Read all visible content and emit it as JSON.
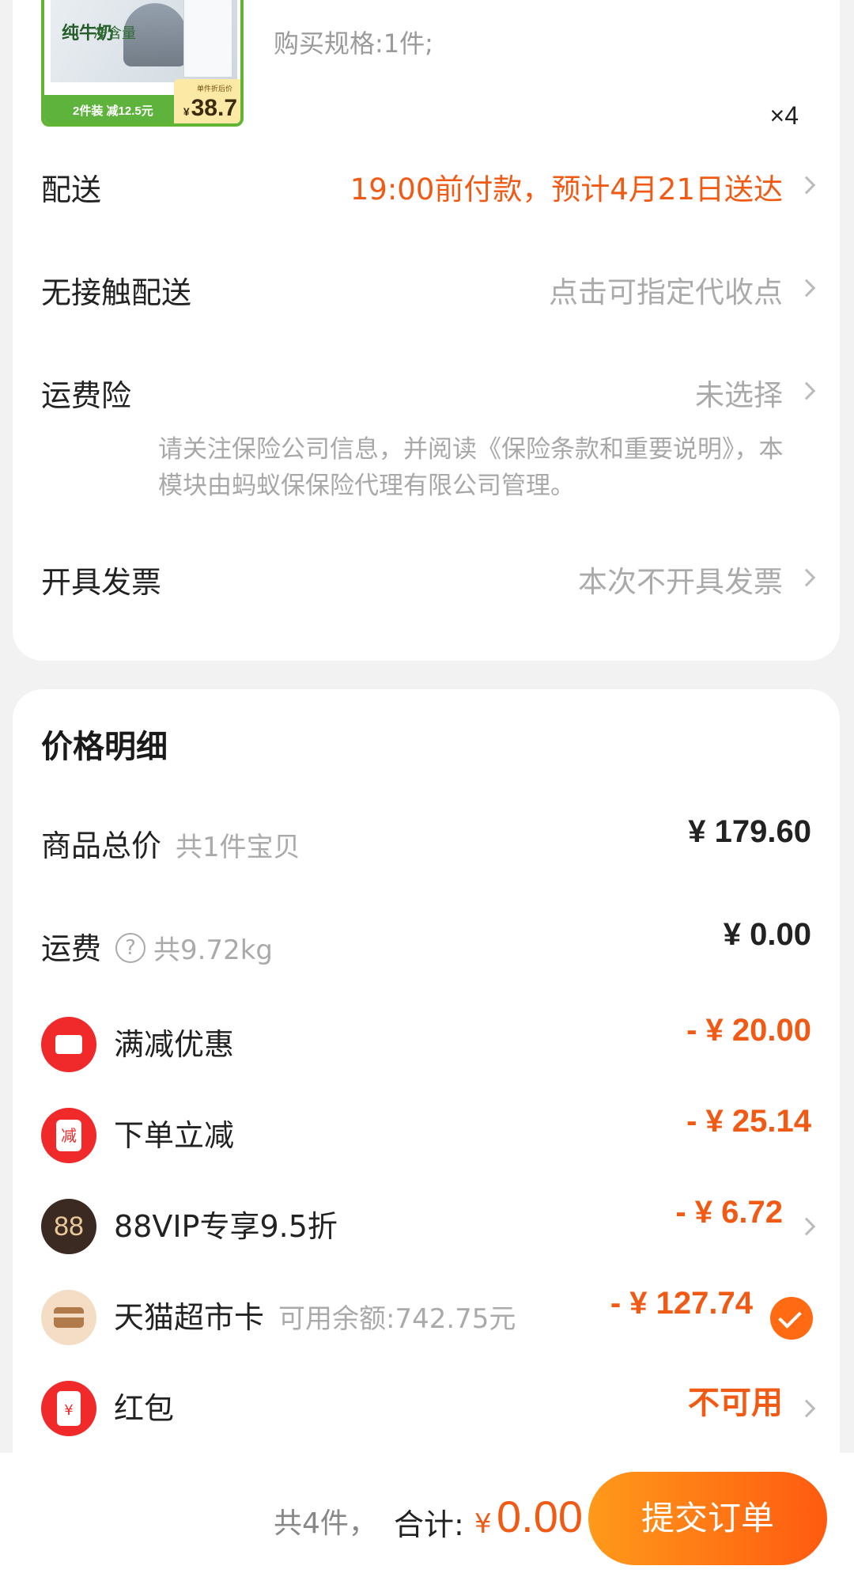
{
  "product": {
    "thumb_brand": "纯牛奶",
    "thumb_net": "净含量",
    "thumb_promo": "2件装 减12.5元",
    "thumb_price_label": "单件折后价",
    "thumb_currency": "¥",
    "thumb_price": "38.7",
    "spec": "购买规格:1件;",
    "quantity": "×4"
  },
  "order_options": [
    {
      "label": "配送",
      "value": "19:00前付款，预计4月21日送达",
      "value_color": "#f05a14"
    },
    {
      "label": "无接触配送",
      "value": "点击可指定代收点"
    },
    {
      "label": "运费险",
      "value": "未选择"
    },
    {
      "label": "开具发票",
      "value": "本次不开具发票"
    }
  ],
  "insurance_note": "请关注保险公司信息，并阅读《保险条款和重要说明》，本模块由蚂蚁保保险代理有限公司管理。",
  "price_details": {
    "title": "价格明细",
    "items_total": {
      "label": "商品总价",
      "sub": "共1件宝贝",
      "amount": "¥ 179.60"
    },
    "shipping": {
      "label": "运费",
      "help": "?",
      "sub": "共9.72kg",
      "amount": "¥ 0.00"
    },
    "discounts": [
      {
        "label": "满减优惠",
        "amount": "- ¥ 20.00",
        "icon": "ticket-icon"
      },
      {
        "label": "下单立减",
        "amount": "- ¥ 25.14",
        "icon": "instant-discount-icon",
        "icon_text": "减"
      },
      {
        "label": "88VIP专享9.5折",
        "amount": "- ¥ 6.72",
        "icon": "88vip-icon",
        "icon_text": "88"
      },
      {
        "label": "天猫超市卡",
        "sub": "可用余额:742.75元",
        "amount": "- ¥ 127.74",
        "icon": "card-icon"
      },
      {
        "label": "红包",
        "amount": "不可用",
        "icon": "red-envelope-icon",
        "icon_text": "¥"
      }
    ]
  },
  "bottom_bar": {
    "count": "共4件，",
    "total_label": "合计:",
    "currency": "¥",
    "total": "0.00",
    "submit": "提交订单"
  },
  "colors": {
    "accent": "#f05a14",
    "button_start": "#ff9a1a",
    "button_end": "#ff5a10",
    "product_border": "#62b534"
  }
}
